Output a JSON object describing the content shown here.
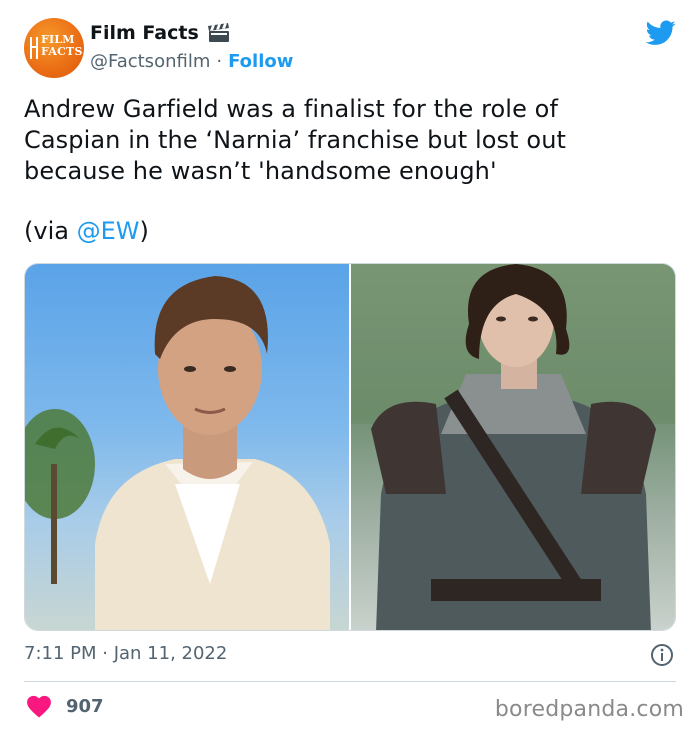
{
  "account": {
    "display_name": "Film Facts",
    "handle": "@Factsonfilm",
    "separator": "·",
    "follow_label": "Follow",
    "avatar_logo_line1": "FILM",
    "avatar_logo_line2": "FACTS",
    "badge_icon": "clapperboard-icon"
  },
  "tweet": {
    "text_line1": "Andrew Garfield was a finalist for the role of",
    "text_line2": "Caspian in the ‘Narnia’ franchise but lost out",
    "text_line3": "because he wasn’t 'handsome enough'",
    "via_prefix": "(via ",
    "via_mention": "@EW",
    "via_suffix": ")",
    "time": "7:11 PM",
    "date_separator": " · ",
    "date": "Jan 11, 2022"
  },
  "engagement": {
    "like_count": "907",
    "like_icon": "heart-icon",
    "info_icon": "info-icon"
  },
  "source": {
    "watermark": "boredpanda.com"
  },
  "colors": {
    "accent": "#1d9bf0",
    "heart": "#f91880",
    "secondary_text": "#536471",
    "avatar_orange": "#ec7016"
  }
}
